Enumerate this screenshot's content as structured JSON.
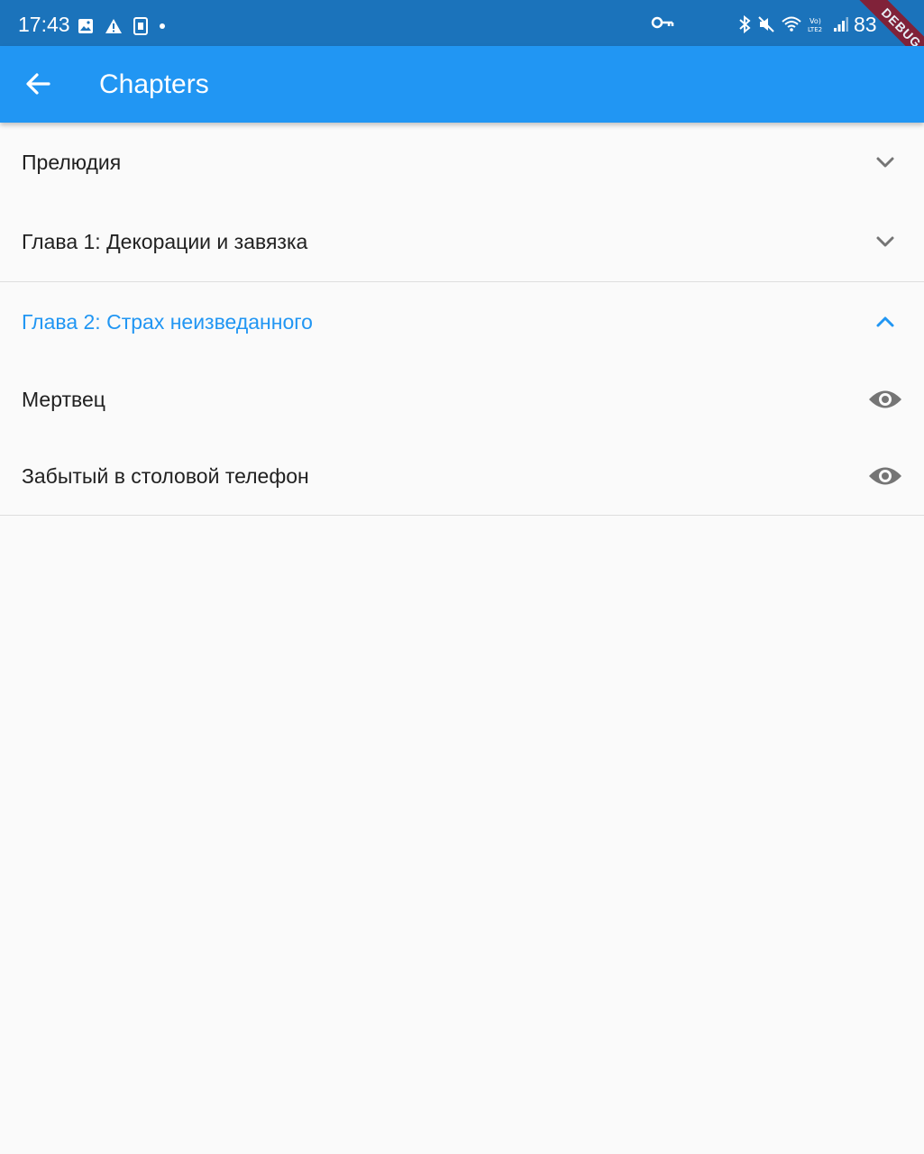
{
  "status_bar": {
    "time": "17:43",
    "battery": "83",
    "icons_left": [
      "image-icon",
      "warning-icon",
      "sim-icon",
      "dot-icon"
    ],
    "icons_right": [
      "key-icon",
      "bluetooth-icon",
      "mute-icon",
      "wifi-icon",
      "volte-icon",
      "signal-icon",
      "battery-icon"
    ],
    "debug_banner": "DEBUG"
  },
  "app_bar": {
    "title": "Chapters",
    "background": "#2196f3"
  },
  "chapters": [
    {
      "title": "Прелюдия",
      "expanded": false
    },
    {
      "title": "Глава 1: Декорации и завязка",
      "expanded": false
    },
    {
      "title": "Глава 2: Страх неизведанного",
      "expanded": true,
      "items": [
        {
          "title": "Мертвец",
          "icon": "eye-icon"
        },
        {
          "title": "Забытый в столовой телефон",
          "icon": "eye-icon"
        }
      ]
    }
  ],
  "colors": {
    "accent": "#2196f3",
    "status_bar": "#1b73bb",
    "icon_grey": "#757575"
  }
}
